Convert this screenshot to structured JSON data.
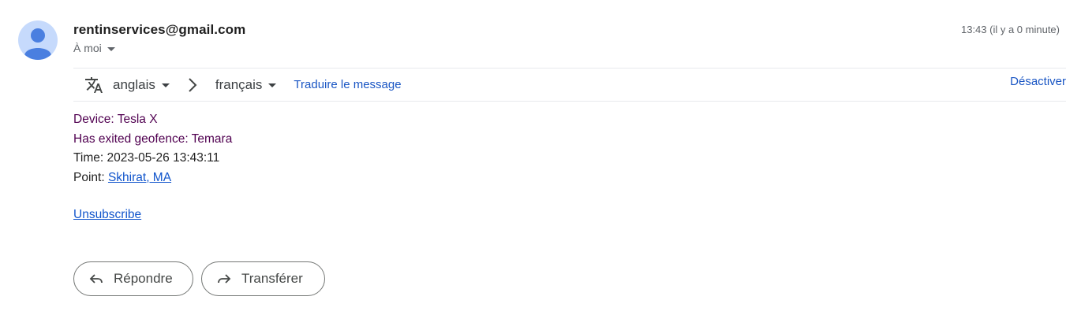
{
  "header": {
    "sender": "rentinservices@gmail.com",
    "recipient_label": "À moi",
    "timestamp": "13:43 (il y a 0 minute)"
  },
  "translate_bar": {
    "source_language": "anglais",
    "target_language": "français",
    "translate_label": "Traduire le message",
    "disable_label": "Désactiver"
  },
  "message": {
    "lines": [
      {
        "prefix": "Device: Tesla X"
      },
      {
        "prefix": "Has exited geofence: Temara"
      },
      {
        "prefix": "Time: 2023-05-26 13:43:11"
      },
      {
        "prefix": "Point: ",
        "link": "Skhirat, MA"
      }
    ],
    "unsubscribe_label": "Unsubscribe"
  },
  "actions": {
    "reply_label": "Répondre",
    "forward_label": "Transférer"
  },
  "colors": {
    "link": "#1155cc",
    "accent_link": "#1a56c4",
    "avatar_bg": "#c6dafc",
    "avatar_fg": "#4a7fe0"
  }
}
